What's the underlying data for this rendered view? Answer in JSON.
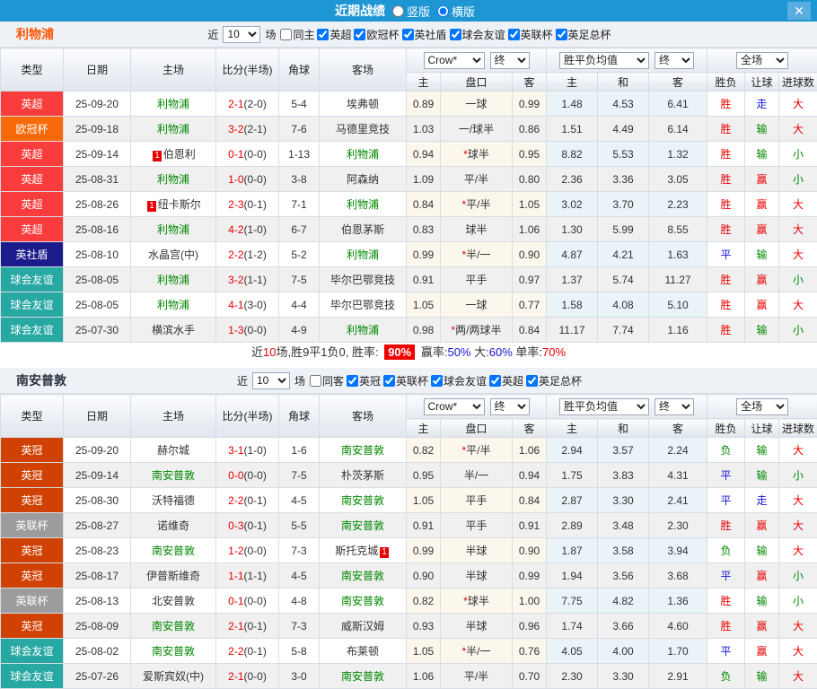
{
  "titlebar": {
    "title": "近期战绩",
    "vertical_label": "竖版",
    "horizontal_label": "横版",
    "selected_layout": "横版",
    "close_glyph": "✕"
  },
  "colors": {
    "titlebar_bg": "#1e96d3",
    "close_button_bg": "#58aee0",
    "win_red": "#e80000",
    "lose_green": "#008800",
    "draw_blue": "#1515d0",
    "summary_badge_bg": "#f00000",
    "handicap_cell_bg": "#fcf7ec",
    "avg_cell_bg": "#e9f3f8"
  },
  "league_colors": {
    "英超": "#fa3c3c",
    "欧冠杯": "#f7690b",
    "英社盾": "#1b1b8c",
    "球会友谊": "#28a8a3",
    "英冠": "#d04204",
    "英联杯": "#9c9c9c"
  },
  "table_header": {
    "type": "类型",
    "date": "日期",
    "home": "主场",
    "score": "比分(半场)",
    "corner": "角球",
    "away": "客场",
    "sub_home": "主",
    "sub_handicap": "盘口",
    "sub_away": "客",
    "sub_win": "主",
    "sub_draw": "和",
    "sub_lose": "客",
    "result": "胜负",
    "handicap": "让球",
    "goals": "进球数"
  },
  "filters": {
    "odds_source": "Crow*",
    "final": "终",
    "avg": "胜平负均值",
    "final2": "终",
    "scope": "全场"
  },
  "sections": [
    {
      "team": "利物浦",
      "team_color": "#ff5500",
      "near_label": "近",
      "games_count": "10",
      "games_label": "场",
      "same_label": "同主",
      "same_checked": false,
      "leagues": [
        "英超",
        "欧冠杯",
        "英社盾",
        "球会友谊",
        "英联杯",
        "英足总杯"
      ],
      "rows": [
        {
          "league": "英超",
          "date": "25-09-20",
          "home": "利物浦",
          "home_self": true,
          "home_badge": "",
          "score": "2-1",
          "half": "(2-0)",
          "corner": "5-4",
          "away": "埃弗顿",
          "away_self": false,
          "away_badge": "",
          "odds": [
            "0.89",
            "一球",
            "0.99"
          ],
          "avg": [
            "1.48",
            "4.53",
            "6.41"
          ],
          "result": [
            "胜",
            "red"
          ],
          "let": [
            "走",
            "blue"
          ],
          "goals": [
            "大",
            "red"
          ]
        },
        {
          "league": "欧冠杯",
          "date": "25-09-18",
          "home": "利物浦",
          "home_self": true,
          "home_badge": "",
          "score": "3-2",
          "half": "(2-1)",
          "corner": "7-6",
          "away": "马德里竞技",
          "away_self": false,
          "away_badge": "",
          "odds": [
            "1.03",
            "一/球半",
            "0.86"
          ],
          "avg": [
            "1.51",
            "4.49",
            "6.14"
          ],
          "result": [
            "胜",
            "red"
          ],
          "let": [
            "输",
            "green"
          ],
          "goals": [
            "大",
            "red"
          ]
        },
        {
          "league": "英超",
          "date": "25-09-14",
          "home": "伯恩利",
          "home_self": false,
          "home_badge": "1",
          "score": "0-1",
          "half": "(0-0)",
          "corner": "1-13",
          "away": "利物浦",
          "away_self": true,
          "away_badge": "",
          "odds": [
            "0.94",
            "*球半",
            "0.95"
          ],
          "avg": [
            "8.82",
            "5.53",
            "1.32"
          ],
          "result": [
            "胜",
            "red"
          ],
          "let": [
            "输",
            "green"
          ],
          "goals": [
            "小",
            "green"
          ]
        },
        {
          "league": "英超",
          "date": "25-08-31",
          "home": "利物浦",
          "home_self": true,
          "home_badge": "",
          "score": "1-0",
          "half": "(0-0)",
          "corner": "3-8",
          "away": "阿森纳",
          "away_self": false,
          "away_badge": "",
          "odds": [
            "1.09",
            "平/半",
            "0.80"
          ],
          "avg": [
            "2.36",
            "3.36",
            "3.05"
          ],
          "result": [
            "胜",
            "red"
          ],
          "let": [
            "赢",
            "red"
          ],
          "goals": [
            "小",
            "green"
          ]
        },
        {
          "league": "英超",
          "date": "25-08-26",
          "home": "纽卡斯尔",
          "home_self": false,
          "home_badge": "1",
          "score": "2-3",
          "half": "(0-1)",
          "corner": "7-1",
          "away": "利物浦",
          "away_self": true,
          "away_badge": "",
          "odds": [
            "0.84",
            "*平/半",
            "1.05"
          ],
          "avg": [
            "3.02",
            "3.70",
            "2.23"
          ],
          "result": [
            "胜",
            "red"
          ],
          "let": [
            "赢",
            "red"
          ],
          "goals": [
            "大",
            "red"
          ]
        },
        {
          "league": "英超",
          "date": "25-08-16",
          "home": "利物浦",
          "home_self": true,
          "home_badge": "",
          "score": "4-2",
          "half": "(1-0)",
          "corner": "6-7",
          "away": "伯恩茅斯",
          "away_self": false,
          "away_badge": "",
          "odds": [
            "0.83",
            "球半",
            "1.06"
          ],
          "avg": [
            "1.30",
            "5.99",
            "8.55"
          ],
          "result": [
            "胜",
            "red"
          ],
          "let": [
            "赢",
            "red"
          ],
          "goals": [
            "大",
            "red"
          ]
        },
        {
          "league": "英社盾",
          "date": "25-08-10",
          "home": "水晶宫(中)",
          "home_self": false,
          "home_badge": "",
          "score": "2-2",
          "half": "(1-2)",
          "corner": "5-2",
          "away": "利物浦",
          "away_self": true,
          "away_badge": "",
          "odds": [
            "0.99",
            "*半/一",
            "0.90"
          ],
          "avg": [
            "4.87",
            "4.21",
            "1.63"
          ],
          "result": [
            "平",
            "blue"
          ],
          "let": [
            "输",
            "green"
          ],
          "goals": [
            "大",
            "red"
          ]
        },
        {
          "league": "球会友谊",
          "date": "25-08-05",
          "home": "利物浦",
          "home_self": true,
          "home_badge": "",
          "score": "3-2",
          "half": "(1-1)",
          "corner": "7-5",
          "away": "毕尔巴鄂竞技",
          "away_self": false,
          "away_badge": "",
          "odds": [
            "0.91",
            "平手",
            "0.97"
          ],
          "avg": [
            "1.37",
            "5.74",
            "11.27"
          ],
          "result": [
            "胜",
            "red"
          ],
          "let": [
            "赢",
            "red"
          ],
          "goals": [
            "小",
            "green"
          ]
        },
        {
          "league": "球会友谊",
          "date": "25-08-05",
          "home": "利物浦",
          "home_self": true,
          "home_badge": "",
          "score": "4-1",
          "half": "(3-0)",
          "corner": "4-4",
          "away": "毕尔巴鄂竞技",
          "away_self": false,
          "away_badge": "",
          "odds": [
            "1.05",
            "一球",
            "0.77"
          ],
          "avg": [
            "1.58",
            "4.08",
            "5.10"
          ],
          "result": [
            "胜",
            "red"
          ],
          "let": [
            "赢",
            "red"
          ],
          "goals": [
            "大",
            "red"
          ]
        },
        {
          "league": "球会友谊",
          "date": "25-07-30",
          "home": "横滨水手",
          "home_self": false,
          "home_badge": "",
          "score": "1-3",
          "half": "(0-0)",
          "corner": "4-9",
          "away": "利物浦",
          "away_self": true,
          "away_badge": "",
          "odds": [
            "0.98",
            "*两/两球半",
            "0.84"
          ],
          "avg": [
            "11.17",
            "7.74",
            "1.16"
          ],
          "result": [
            "胜",
            "red"
          ],
          "let": [
            "输",
            "green"
          ],
          "goals": [
            "小",
            "green"
          ]
        }
      ],
      "summary_parts": [
        {
          "text": "近",
          "style": "plain"
        },
        {
          "text": "10",
          "style": "red"
        },
        {
          "text": "场,胜9平1负0, 胜率: ",
          "style": "plain"
        },
        {
          "text": "90%",
          "style": "badge"
        },
        {
          "text": " 赢率:",
          "style": "plain"
        },
        {
          "text": "50%",
          "style": "blue"
        },
        {
          "text": " 大:",
          "style": "plain"
        },
        {
          "text": "60%",
          "style": "blue"
        },
        {
          "text": " 单率:",
          "style": "plain"
        },
        {
          "text": "70%",
          "style": "red"
        }
      ]
    },
    {
      "team": "南安普敦",
      "team_color": "#2b3340",
      "near_label": "近",
      "games_count": "10",
      "games_label": "场",
      "same_label": "同客",
      "same_checked": false,
      "leagues": [
        "英冠",
        "英联杯",
        "球会友谊",
        "英超",
        "英足总杯"
      ],
      "rows": [
        {
          "league": "英冠",
          "date": "25-09-20",
          "home": "赫尔城",
          "home_self": false,
          "home_badge": "",
          "score": "3-1",
          "half": "(1-0)",
          "corner": "1-6",
          "away": "南安普敦",
          "away_self": true,
          "away_badge": "",
          "odds": [
            "0.82",
            "*平/半",
            "1.06"
          ],
          "avg": [
            "2.94",
            "3.57",
            "2.24"
          ],
          "result": [
            "负",
            "green"
          ],
          "let": [
            "输",
            "green"
          ],
          "goals": [
            "大",
            "red"
          ]
        },
        {
          "league": "英冠",
          "date": "25-09-14",
          "home": "南安普敦",
          "home_self": true,
          "home_badge": "",
          "score": "0-0",
          "half": "(0-0)",
          "corner": "7-5",
          "away": "朴茨茅斯",
          "away_self": false,
          "away_badge": "",
          "odds": [
            "0.95",
            "半/一",
            "0.94"
          ],
          "avg": [
            "1.75",
            "3.83",
            "4.31"
          ],
          "result": [
            "平",
            "blue"
          ],
          "let": [
            "输",
            "green"
          ],
          "goals": [
            "小",
            "green"
          ]
        },
        {
          "league": "英冠",
          "date": "25-08-30",
          "home": "沃特福德",
          "home_self": false,
          "home_badge": "",
          "score": "2-2",
          "half": "(0-1)",
          "corner": "4-5",
          "away": "南安普敦",
          "away_self": true,
          "away_badge": "",
          "odds": [
            "1.05",
            "平手",
            "0.84"
          ],
          "avg": [
            "2.87",
            "3.30",
            "2.41"
          ],
          "result": [
            "平",
            "blue"
          ],
          "let": [
            "走",
            "blue"
          ],
          "goals": [
            "大",
            "red"
          ]
        },
        {
          "league": "英联杯",
          "date": "25-08-27",
          "home": "诺维奇",
          "home_self": false,
          "home_badge": "",
          "score": "0-3",
          "half": "(0-1)",
          "corner": "5-5",
          "away": "南安普敦",
          "away_self": true,
          "away_badge": "",
          "odds": [
            "0.91",
            "平手",
            "0.91"
          ],
          "avg": [
            "2.89",
            "3.48",
            "2.30"
          ],
          "result": [
            "胜",
            "red"
          ],
          "let": [
            "赢",
            "red"
          ],
          "goals": [
            "大",
            "red"
          ]
        },
        {
          "league": "英冠",
          "date": "25-08-23",
          "home": "南安普敦",
          "home_self": true,
          "home_badge": "",
          "score": "1-2",
          "half": "(0-0)",
          "corner": "7-3",
          "away": "斯托克城",
          "away_self": false,
          "away_badge": "1",
          "odds": [
            "0.99",
            "半球",
            "0.90"
          ],
          "avg": [
            "1.87",
            "3.58",
            "3.94"
          ],
          "result": [
            "负",
            "green"
          ],
          "let": [
            "输",
            "green"
          ],
          "goals": [
            "大",
            "red"
          ]
        },
        {
          "league": "英冠",
          "date": "25-08-17",
          "home": "伊普斯维奇",
          "home_self": false,
          "home_badge": "",
          "score": "1-1",
          "half": "(1-1)",
          "corner": "4-5",
          "away": "南安普敦",
          "away_self": true,
          "away_badge": "",
          "odds": [
            "0.90",
            "半球",
            "0.99"
          ],
          "avg": [
            "1.94",
            "3.56",
            "3.68"
          ],
          "result": [
            "平",
            "blue"
          ],
          "let": [
            "赢",
            "red"
          ],
          "goals": [
            "小",
            "green"
          ]
        },
        {
          "league": "英联杯",
          "date": "25-08-13",
          "home": "北安普敦",
          "home_self": false,
          "home_badge": "",
          "score": "0-1",
          "half": "(0-0)",
          "corner": "4-8",
          "away": "南安普敦",
          "away_self": true,
          "away_badge": "",
          "odds": [
            "0.82",
            "*球半",
            "1.00"
          ],
          "avg": [
            "7.75",
            "4.82",
            "1.36"
          ],
          "result": [
            "胜",
            "red"
          ],
          "let": [
            "输",
            "green"
          ],
          "goals": [
            "小",
            "green"
          ]
        },
        {
          "league": "英冠",
          "date": "25-08-09",
          "home": "南安普敦",
          "home_self": true,
          "home_badge": "",
          "score": "2-1",
          "half": "(0-1)",
          "corner": "7-3",
          "away": "威斯汉姆",
          "away_self": false,
          "away_badge": "",
          "odds": [
            "0.93",
            "半球",
            "0.96"
          ],
          "avg": [
            "1.74",
            "3.66",
            "4.60"
          ],
          "result": [
            "胜",
            "red"
          ],
          "let": [
            "赢",
            "red"
          ],
          "goals": [
            "大",
            "red"
          ]
        },
        {
          "league": "球会友谊",
          "date": "25-08-02",
          "home": "南安普敦",
          "home_self": true,
          "home_badge": "",
          "score": "2-2",
          "half": "(0-1)",
          "corner": "5-8",
          "away": "布莱顿",
          "away_self": false,
          "away_badge": "",
          "odds": [
            "1.05",
            "*半/一",
            "0.76"
          ],
          "avg": [
            "4.05",
            "4.00",
            "1.70"
          ],
          "result": [
            "平",
            "blue"
          ],
          "let": [
            "赢",
            "red"
          ],
          "goals": [
            "大",
            "red"
          ]
        },
        {
          "league": "球会友谊",
          "date": "25-07-26",
          "home": "爱斯宾奴(中)",
          "home_self": false,
          "home_badge": "",
          "score": "2-1",
          "half": "(0-0)",
          "corner": "3-0",
          "away": "南安普敦",
          "away_self": true,
          "away_badge": "",
          "odds": [
            "1.06",
            "平/半",
            "0.70"
          ],
          "avg": [
            "2.30",
            "3.30",
            "2.91"
          ],
          "result": [
            "负",
            "green"
          ],
          "let": [
            "输",
            "green"
          ],
          "goals": [
            "大",
            "red"
          ]
        }
      ],
      "summary_parts": []
    }
  ]
}
